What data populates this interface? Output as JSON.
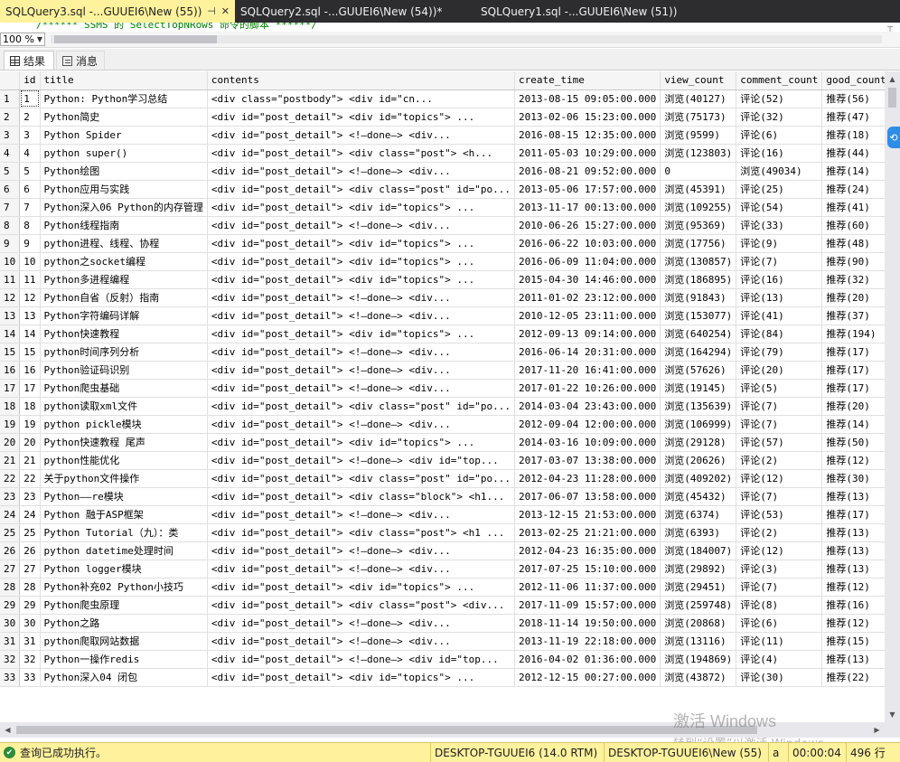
{
  "tabs": [
    {
      "label": "SQLQuery3.sql -...GUUEI6\\New (55))",
      "active": true
    },
    {
      "label": "SQLQuery2.sql -...GUUEI6\\New (54))*",
      "active": false
    },
    {
      "label": "SQLQuery1.sql -...GUUEI6\\New (51))",
      "active": false
    }
  ],
  "tab_icons": {
    "pin": "pin-icon",
    "close": "close-icon"
  },
  "editor": {
    "code_line": "/****** SSMS 的 SelectTopNRows 命令的脚本 ******/"
  },
  "zoom": {
    "value": "100 %"
  },
  "result_tabs": {
    "results": "结果",
    "messages": "消息"
  },
  "grid": {
    "columns": [
      "",
      "id",
      "title",
      "contents",
      "create_time",
      "view_count",
      "comment_count",
      "good_count"
    ],
    "rows": [
      [
        "1",
        "1",
        "Python: Python学习总结",
        "<div class=\"postbody\">          <div id=\"cn...",
        "2013-08-15 09:05:00.000",
        "浏览(40127)",
        "评论(52)",
        "推荐(56)"
      ],
      [
        "2",
        "2",
        "Python简史",
        "<div id=\"post_detail\">     <div id=\"topics\">   ...",
        "2013-02-06 15:23:00.000",
        "浏览(75173)",
        "评论(32)",
        "推荐(47)"
      ],
      [
        "3",
        "3",
        "Python Spider",
        "<div id=\"post_detail\">     <!—done—>     <div...",
        "2016-08-15 12:35:00.000",
        "浏览(9599)",
        "评论(6)",
        "推荐(18)"
      ],
      [
        "4",
        "4",
        "python super()",
        "<div id=\"post_detail\">  <div class=\"post\">   <h...",
        "2011-05-03 10:29:00.000",
        "浏览(123803)",
        "评论(16)",
        "推荐(44)"
      ],
      [
        "5",
        "5",
        "Python绘图",
        "<div id=\"post_detail\">     <!—done—>     <div...",
        "2016-08-21 09:52:00.000",
        "0",
        "浏览(49034)",
        "推荐(14)"
      ],
      [
        "6",
        "6",
        "Python应用与实践",
        "<div id=\"post_detail\"> <div class=\"post\" id=\"po...",
        "2013-05-06 17:57:00.000",
        "浏览(45391)",
        "评论(25)",
        "推荐(24)"
      ],
      [
        "7",
        "7",
        "Python深入06 Python的内存管理",
        "<div id=\"post_detail\">     <div id=\"topics\">   ...",
        "2013-11-17 00:13:00.000",
        "浏览(109255)",
        "评论(54)",
        "推荐(41)"
      ],
      [
        "8",
        "8",
        "Python线程指南",
        "<div id=\"post_detail\">     <!—done—>     <div...",
        "2010-06-26 15:27:00.000",
        "浏览(95369)",
        "评论(33)",
        "推荐(60)"
      ],
      [
        "9",
        "9",
        "python进程、线程、协程",
        "<div id=\"post_detail\">     <div id=\"topics\">   ...",
        "2016-06-22 10:03:00.000",
        "浏览(17756)",
        "评论(9)",
        "推荐(48)"
      ],
      [
        "10",
        "10",
        "python之socket编程",
        "<div id=\"post_detail\">     <div id=\"topics\">   ...",
        "2016-06-09 11:04:00.000",
        "浏览(130857)",
        "评论(7)",
        "推荐(90)"
      ],
      [
        "11",
        "11",
        "Python多进程编程",
        "<div id=\"post_detail\">     <div id=\"topics\">   ...",
        "2015-04-30 14:46:00.000",
        "浏览(186895)",
        "评论(16)",
        "推荐(32)"
      ],
      [
        "12",
        "12",
        "Python自省（反射）指南",
        "<div id=\"post_detail\">     <!—done—>     <div...",
        "2011-01-02 23:12:00.000",
        "浏览(91843)",
        "评论(13)",
        "推荐(20)"
      ],
      [
        "13",
        "13",
        "Python字符编码详解",
        "<div id=\"post_detail\">     <!—done—>     <div...",
        "2010-12-05 23:11:00.000",
        "浏览(153077)",
        "评论(41)",
        "推荐(37)"
      ],
      [
        "14",
        "14",
        "Python快速教程",
        "<div id=\"post_detail\">     <div id=\"topics\">   ...",
        "2012-09-13 09:14:00.000",
        "浏览(640254)",
        "评论(84)",
        "推荐(194)"
      ],
      [
        "15",
        "15",
        "python时间序列分析",
        "<div id=\"post_detail\">     <!—done—>     <div...",
        "2016-06-14 20:31:00.000",
        "浏览(164294)",
        "评论(79)",
        "推荐(17)"
      ],
      [
        "16",
        "16",
        "Python验证码识别",
        "<div id=\"post_detail\">     <!—done—>     <div...",
        "2017-11-20 16:41:00.000",
        "浏览(57626)",
        "评论(20)",
        "推荐(17)"
      ],
      [
        "17",
        "17",
        "Python爬虫基础",
        "<div id=\"post_detail\">     <!—done—>     <div...",
        "2017-01-22 10:26:00.000",
        "浏览(19145)",
        "评论(5)",
        "推荐(17)"
      ],
      [
        "18",
        "18",
        "python读取xml文件",
        "<div id=\"post_detail\"> <div class=\"post\" id=\"po...",
        "2014-03-04 23:43:00.000",
        "浏览(135639)",
        "评论(7)",
        "推荐(20)"
      ],
      [
        "19",
        "19",
        "python pickle模块",
        "<div id=\"post_detail\">     <!—done—>     <div...",
        "2012-09-04 12:00:00.000",
        "浏览(106999)",
        "评论(7)",
        "推荐(14)"
      ],
      [
        "20",
        "20",
        "Python快速教程 尾声",
        "<div id=\"post_detail\">     <div id=\"topics\">   ...",
        "2014-03-16 10:09:00.000",
        "浏览(29128)",
        "评论(57)",
        "推荐(50)"
      ],
      [
        "21",
        "21",
        "python性能优化",
        "<div id=\"post_detail\"> <!—done—>  <div id=\"top...",
        "2017-03-07 13:38:00.000",
        "浏览(20626)",
        "评论(2)",
        "推荐(12)"
      ],
      [
        "22",
        "22",
        "关于python文件操作",
        "<div id=\"post_detail\"> <div class=\"post\" id=\"po...",
        "2012-04-23 11:28:00.000",
        "浏览(409202)",
        "评论(12)",
        "推荐(30)"
      ],
      [
        "23",
        "23",
        "Python——re模块",
        "<div id=\"post_detail\"> <div class=\"block\">  <h1...",
        "2017-06-07 13:58:00.000",
        "浏览(45432)",
        "评论(7)",
        "推荐(13)"
      ],
      [
        "24",
        "24",
        "Python 融于ASP框架",
        "<div id=\"post_detail\">     <!—done—>     <div...",
        "2013-12-15 21:53:00.000",
        "浏览(6374)",
        "评论(53)",
        "推荐(17)"
      ],
      [
        "25",
        "25",
        "Python Tutorial（九）：类",
        "<div id=\"post_detail\">     <div class=\"post\">   <h1 ...",
        "2013-02-25 21:21:00.000",
        "浏览(6393)",
        "评论(2)",
        "推荐(13)"
      ],
      [
        "26",
        "26",
        "python datetime处理时间",
        "<div id=\"post_detail\">     <!—done—>     <div...",
        "2012-04-23 16:35:00.000",
        "浏览(184007)",
        "评论(12)",
        "推荐(13)"
      ],
      [
        "27",
        "27",
        "Python logger模块",
        "<div id=\"post_detail\">     <!—done—>     <div...",
        "2017-07-25 15:10:00.000",
        "浏览(29892)",
        "评论(3)",
        "推荐(13)"
      ],
      [
        "28",
        "28",
        "Python补充02 Python小技巧",
        "<div id=\"post_detail\">     <div id=\"topics\">   ...",
        "2012-11-06 11:37:00.000",
        "浏览(29451)",
        "评论(7)",
        "推荐(12)"
      ],
      [
        "29",
        "29",
        "Python爬虫原理",
        "<div id=\"post_detail\">     <div class=\"post\">   <div...",
        "2017-11-09 15:57:00.000",
        "浏览(259748)",
        "评论(8)",
        "推荐(16)"
      ],
      [
        "30",
        "30",
        "Python之路",
        "<div id=\"post_detail\">     <!—done—>     <div...",
        "2018-11-14 19:50:00.000",
        "浏览(20868)",
        "评论(6)",
        "推荐(12)"
      ],
      [
        "31",
        "31",
        "python爬取网站数据",
        "<div id=\"post_detail\">     <!—done—>     <div...",
        "2013-11-19 22:18:00.000",
        "浏览(13116)",
        "评论(11)",
        "推荐(15)"
      ],
      [
        "32",
        "32",
        "Python一操作redis",
        "<div id=\"post_detail\"> <!—done—>  <div id=\"top...",
        "2016-04-02 01:36:00.000",
        "浏览(194869)",
        "评论(4)",
        "推荐(13)"
      ],
      [
        "33",
        "33",
        "Python深入04 闭包",
        "<div id=\"post_detail\">     <div id=\"topics\">   ...",
        "2012-12-15 00:27:00.000",
        "浏览(43872)",
        "评论(30)",
        "推荐(22)"
      ]
    ]
  },
  "watermark": {
    "line1": "激活 Windows",
    "line2": "转到“设置”以激活 Windows。"
  },
  "status": {
    "message": "查询已成功执行。",
    "server": "DESKTOP-TGUUEI6 (14.0 RTM)",
    "connection": "DESKTOP-TGUUEI6\\New (55)",
    "db": "a",
    "elapsed": "00:00:04",
    "rows": "496 行"
  },
  "colors": {
    "active_tab": "#fff29d",
    "tabstrip": "#2d2d30",
    "status_ok": "#2e8b3a",
    "status_bar": "#fff29d"
  }
}
